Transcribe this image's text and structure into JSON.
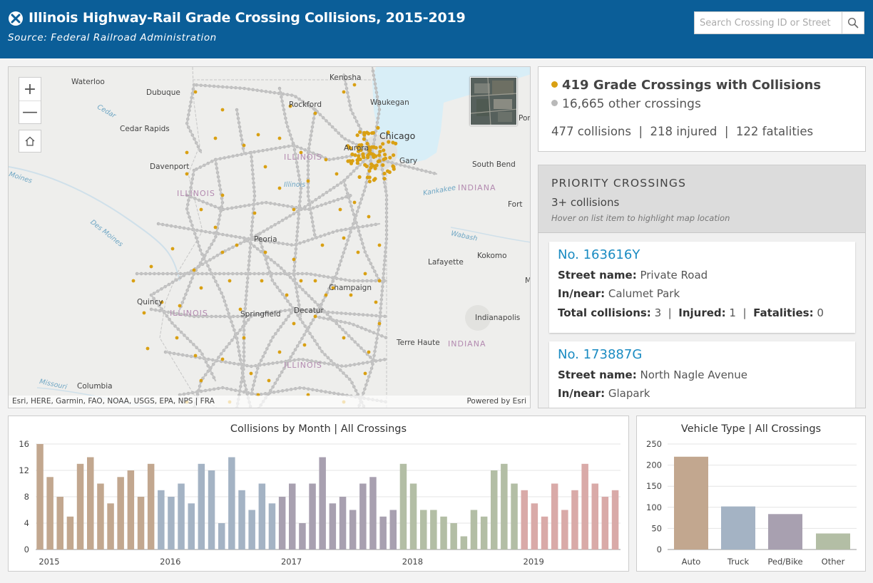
{
  "header": {
    "title": "Illinois Highway-Rail Grade Crossing Collisions, 2015-2019",
    "subtitle": "Source: Federal Railroad Administration",
    "search_placeholder": "Search Crossing ID or Street"
  },
  "map": {
    "labels": {
      "waterloo": "Waterloo",
      "dubuque": "Dubuque",
      "cedar": "Cedar",
      "cedar_rapids": "Cedar Rapids",
      "davenport": "Davenport",
      "moines": "Moines",
      "des_moines": "Des Moines",
      "kenosha": "Kenosha",
      "waukegan": "Waukegan",
      "rockford": "Rockford",
      "chicago": "Chicago",
      "aurora": "Aurora",
      "gary": "Gary",
      "south_bend": "South Bend",
      "kankakee": "Kankakee",
      "fort": "Fort",
      "wabash": "Wabash",
      "peoria": "Peoria",
      "kokomo": "Kokomo",
      "lafayette": "Lafayette",
      "champaign": "Champaign",
      "quincy": "Quincy",
      "springfield": "Springfield",
      "decatur": "Decatur",
      "indianapolis": "Indianapolis",
      "terre_haute": "Terre Haute",
      "columbia": "Columbia",
      "missouri": "Missouri",
      "port": "Port",
      "m": "M"
    },
    "state_labels": {
      "illinois_1": "ILLINOIS",
      "illinois_2": "ILLINOIS",
      "illinois_3": "ILLINOIS",
      "illinois_4": "ILLINOIS",
      "illinois_5": "Illinois",
      "indiana_1": "INDIANA",
      "indiana_2": "INDIANA"
    },
    "zoom_in": "+",
    "zoom_out": "—",
    "attribution_left": "Esri, HERE, Garmin, FAO, NOAA, USGS, EPA, NPS | FRA",
    "attribution_right": "Powered by Esri",
    "colors": {
      "collision": "#d9a013",
      "other": "#b9b9b9",
      "lake": "#d8eef7"
    }
  },
  "stats": {
    "primary": "419 Grade Crossings with Collisions",
    "secondary": "16,665 other crossings",
    "totals": "477 collisions  |  218 injured  |  122 fatalities"
  },
  "priority": {
    "title": "PRIORITY CROSSINGS",
    "subtitle": "3+ collisions",
    "hint": "Hover on list item to highlight map location",
    "cards": [
      {
        "id": "No. 163616Y",
        "street_label": "Street name:",
        "street": " Private Road",
        "near_label": "In/near:",
        "near": " Calumet Park",
        "collisions_label": "Total collisions:",
        "collisions": " 3",
        "sep1": "  |  ",
        "injured_label": "Injured:",
        "injured": " 1",
        "sep2": "  |  ",
        "fatalities_label": "Fatalities:",
        "fatalities": " 0"
      },
      {
        "id": "No. 173887G",
        "street_label": "Street name:",
        "street": " North Nagle Avenue",
        "near_label": "In/near:",
        "near": " Glapark"
      }
    ]
  },
  "chart_data": [
    {
      "type": "bar",
      "title": "Collisions by Month | All Crossings",
      "ylim": [
        0,
        16
      ],
      "yticks": [
        "0",
        "4",
        "8",
        "12",
        "16"
      ],
      "year_labels": [
        "2015",
        "2016",
        "2017",
        "2018",
        "2019"
      ],
      "series": [
        {
          "name": "2015",
          "color": "#c2a78f",
          "values": [
            16,
            11,
            8,
            5,
            13,
            14,
            10,
            7,
            11,
            12,
            8,
            13
          ]
        },
        {
          "name": "2016",
          "color": "#a4b3c4",
          "values": [
            9,
            8,
            10,
            7,
            13,
            12,
            4,
            14,
            9,
            6,
            10,
            7
          ]
        },
        {
          "name": "2017",
          "color": "#a8a0b0",
          "values": [
            8,
            10,
            4,
            10,
            14,
            7,
            8,
            6,
            10,
            11,
            5,
            6
          ]
        },
        {
          "name": "2018",
          "color": "#b3bea5",
          "values": [
            13,
            10,
            6,
            6,
            5,
            4,
            2,
            6,
            5,
            12,
            13,
            10
          ]
        },
        {
          "name": "2019",
          "color": "#d9aaa8",
          "values": [
            9,
            7,
            5,
            10,
            6,
            9,
            13,
            10,
            8,
            9
          ]
        }
      ]
    },
    {
      "type": "bar",
      "title": "Vehicle Type | All Crossings",
      "ylim": [
        0,
        250
      ],
      "yticks": [
        "0",
        "50",
        "100",
        "150",
        "200",
        "250"
      ],
      "categories": [
        "Auto",
        "Truck",
        "Ped/Bike",
        "Other"
      ],
      "values": [
        220,
        102,
        84,
        38
      ],
      "colors": [
        "#c2a78f",
        "#a4b3c4",
        "#a8a0b0",
        "#b3bea5"
      ]
    }
  ]
}
